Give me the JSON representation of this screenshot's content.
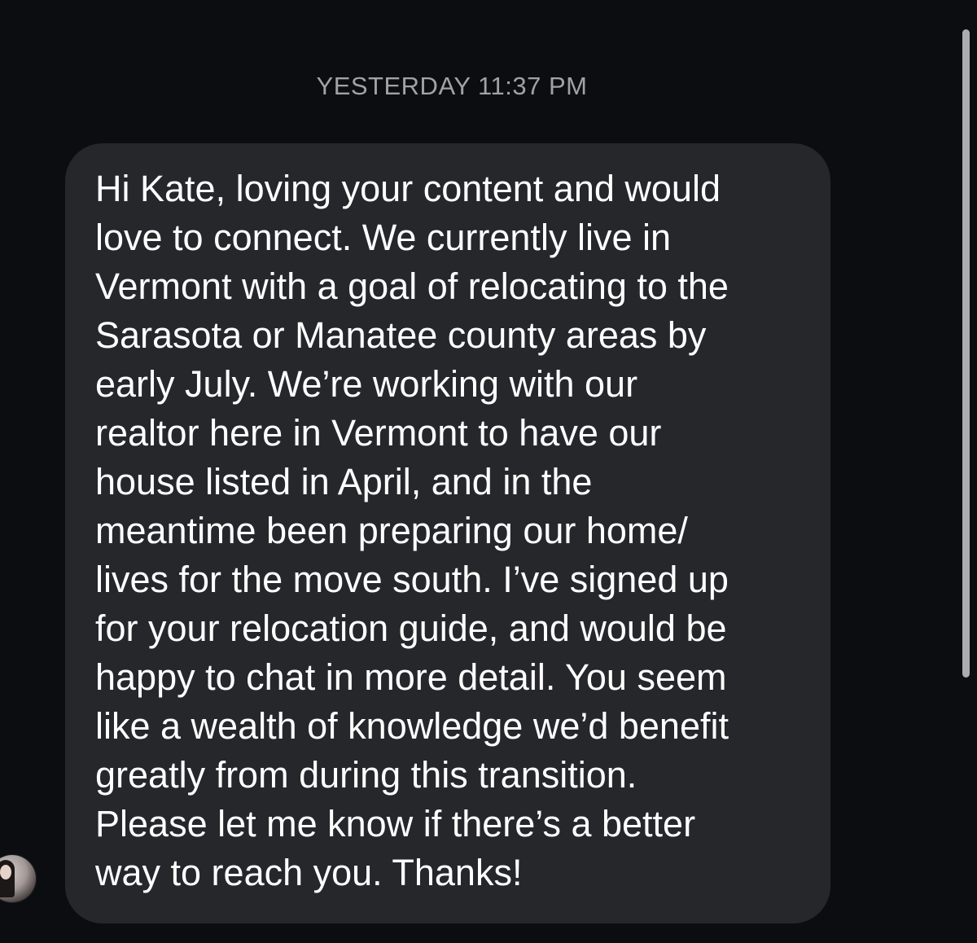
{
  "conversation": {
    "timestamp": "YESTERDAY 11:37 PM",
    "message": {
      "text": "Hi Kate, loving your content and would\nlove to connect. We currently live in\nVermont with a goal of relocating to the\nSarasota or Manatee county areas by\nearly July. We’re working with our\nrealtor here in Vermont to have our\nhouse listed in April, and in the\nmeantime been preparing our home/\nlives for the move south. I’ve signed up\nfor your relocation guide, and would be\nhappy to chat in more detail. You seem\nlike a wealth of knowledge we’d benefit\ngreatly from during this transition.\nPlease let me know if there’s a better\nway to reach you. Thanks!"
    },
    "sender": {
      "avatar_icon": "profile-photo"
    }
  },
  "colors": {
    "background": "#0c0d11",
    "bubble": "#25272b",
    "timestamp": "#a0a2a8",
    "text": "#ffffff"
  }
}
